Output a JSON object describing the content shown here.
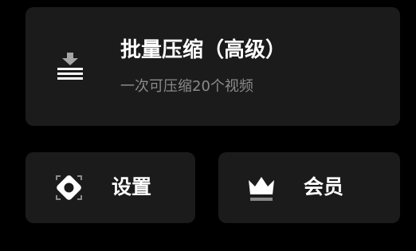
{
  "batch_compress": {
    "title": "批量压缩（高级）",
    "subtitle": "一次可压缩20个视频",
    "icon": "compress-download-icon"
  },
  "settings": {
    "label": "设置",
    "icon": "settings-diamond-icon"
  },
  "vip": {
    "label": "会员",
    "icon": "crown-icon"
  },
  "colors": {
    "background": "#000000",
    "card": "#1b1b1b",
    "text_primary": "#ffffff",
    "text_secondary": "#8a8a8a"
  }
}
